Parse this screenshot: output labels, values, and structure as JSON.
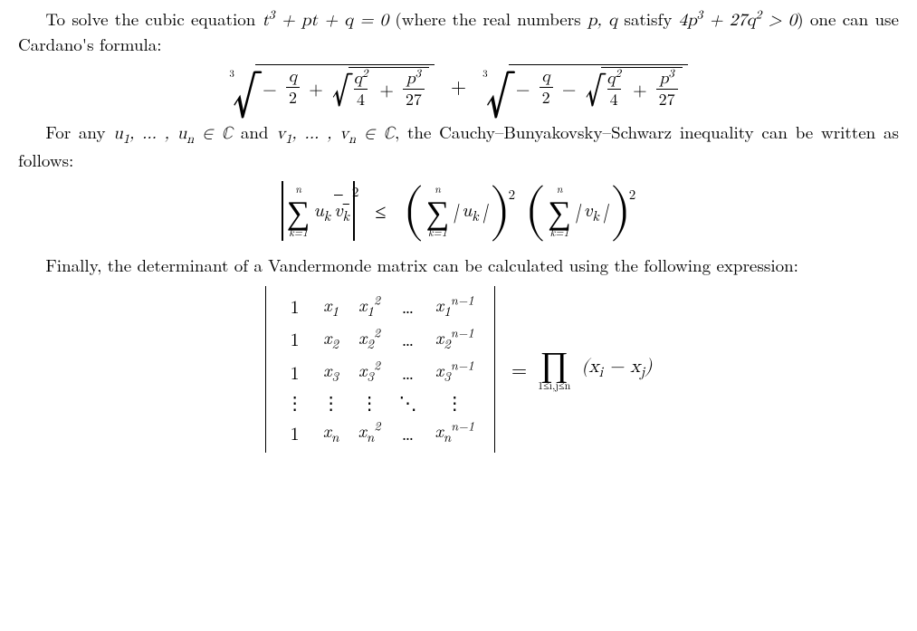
{
  "para1_a": "To solve the cubic equation ",
  "para1_eq": "t³ + pt + q = 0",
  "para1_b": " (where the real numbers ",
  "para1_vars": "p, q",
  "para1_c": " satisfy ",
  "para1_cond": "4p³ + 27q² > 0",
  "para1_d": ") one can use Cardano's formula:",
  "cardano": {
    "root_index": "3",
    "neg_q_over_2_num": "q",
    "neg_q_over_2_den": "2",
    "q2_over_4_num": "q²",
    "q2_over_4_den": "4",
    "p3_over_27_num": "p³",
    "p3_over_27_den": "27"
  },
  "para2_a": "For any ",
  "para2_u": "u₁, … , uₙ ∈ ℂ",
  "para2_b": " and ",
  "para2_v": "v₁, … , vₙ ∈ ℂ",
  "para2_c": ", the Cauchy–Bunyakovsky–Schwarz inequality can be written as follows:",
  "cs": {
    "sum_upper": "n",
    "sum_lower": "k=1",
    "lhs_term": "uₖ v̄ₖ",
    "mid_term": "|uₖ|",
    "rhs_term": "|vₖ|",
    "power": "2",
    "leq": "≤"
  },
  "para3": "Finally, the determinant of a Vandermonde matrix can be calculated using the following expression:",
  "vandermonde": {
    "matrix": [
      [
        "1",
        "x₁",
        "x₁²",
        "…",
        "x₁ⁿ⁻¹"
      ],
      [
        "1",
        "x₂",
        "x₂²",
        "…",
        "x₂ⁿ⁻¹"
      ],
      [
        "1",
        "x₃",
        "x₃²",
        "…",
        "x₃ⁿ⁻¹"
      ],
      [
        "⋮",
        "⋮",
        "⋮",
        "⋱",
        "⋮"
      ],
      [
        "1",
        "xₙ",
        "xₙ²",
        "…",
        "xₙⁿ⁻¹"
      ]
    ],
    "equals": "=",
    "prod_limits": "1≤i,j≤n",
    "prod_term": "(xᵢ − xⱼ)"
  }
}
